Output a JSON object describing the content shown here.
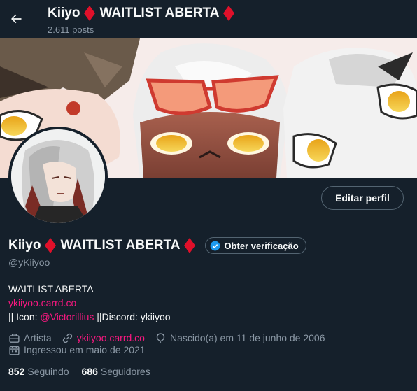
{
  "header": {
    "name_text": "Kiiyo",
    "name_suffix": "WAITLIST ABERTA",
    "posts_count": "2.611 posts"
  },
  "profile": {
    "name_text": "Kiiyo",
    "name_suffix": "WAITLIST ABERTA",
    "handle": "@yKiiyoo",
    "edit_label": "Editar perfil",
    "verify_label": "Obter verificação",
    "bio_line1": "WAITLIST ABERTA",
    "bio_link": "ykiiyoo.carrd.co",
    "bio_line3_pre": "|| Icon: ",
    "bio_line3_mention": "@Victorillius",
    "bio_line3_post": " ||Discord: ykiiyoo",
    "category": "Artista",
    "website": "ykiiyoo.carrd.co",
    "birthday": "Nascido(a) em 11 de junho de 2006",
    "joined": "Ingressou em maio de 2021",
    "following_count": "852",
    "following_label": "Seguindo",
    "followers_count": "686",
    "followers_label": "Seguidores"
  },
  "colors": {
    "background": "#15202b",
    "accent_pink": "#f91880",
    "diamond_red": "#e0102a",
    "verify_blue": "#1d9bf0",
    "secondary_text": "#8b98a5"
  },
  "icons": [
    "arrow-left-icon",
    "diamond-icon",
    "verified-badge-icon",
    "briefcase-icon",
    "link-icon",
    "balloon-icon",
    "calendar-icon"
  ]
}
